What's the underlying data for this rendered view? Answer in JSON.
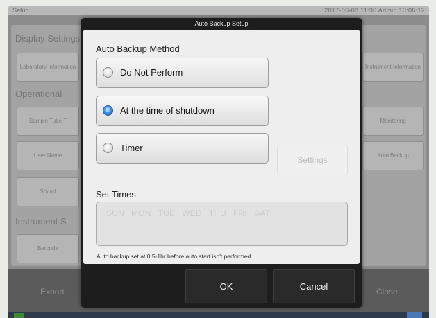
{
  "background": {
    "window_title_left": "Setup",
    "window_title_right": "2017-06-08 11:30 Admin 10:06:12",
    "sections": {
      "display": "Display Settings",
      "operational": "Operational",
      "instrument": "Instrument S"
    },
    "buttons": {
      "laboratory_information": "Laboratory Information",
      "sample_tube": "Sample Tube T",
      "user_name": "User Name",
      "sound": "Sound",
      "barcode": "Barcode",
      "instrument_information": "Instrument Information",
      "monitoring": "Monitoring",
      "auto_backup": "Auto Backup"
    },
    "footer": {
      "export": "Export",
      "close": "Close"
    }
  },
  "dialog": {
    "title": "Auto Backup Setup",
    "method_label": "Auto Backup Method",
    "options": [
      {
        "label": "Do Not Perform",
        "selected": false
      },
      {
        "label": "At the time of shutdown",
        "selected": true
      },
      {
        "label": "Timer",
        "selected": false
      }
    ],
    "settings_button": "Settings",
    "set_times_label": "Set Times",
    "days": [
      "SUN",
      "MON",
      "TUE",
      "WED",
      "THU",
      "FRI",
      "SAT"
    ],
    "note": "Auto backup set at 0.5-1hr before auto start isn't performed.",
    "ok": "OK",
    "cancel": "Cancel"
  },
  "colors": {
    "selected_radio": "#3b8ee6",
    "dialog_frame": "#1d1d1d",
    "dialog_body": "#eeeeee"
  }
}
